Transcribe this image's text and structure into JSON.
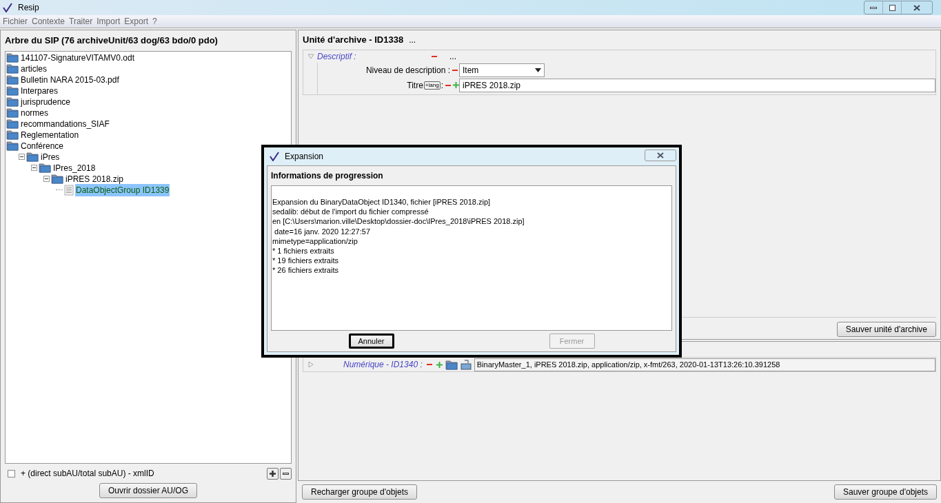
{
  "window": {
    "title": "Resip"
  },
  "menu": [
    "Fichier",
    "Contexte",
    "Traiter",
    "Import",
    "Export",
    "?"
  ],
  "tree_panel": {
    "title": "Arbre du SIP (76 archiveUnit/63 dog/63 bdo/0 pdo)",
    "items": [
      {
        "label": "141107-SignatureVITAMV0.odt",
        "kind": "folder",
        "selected": false
      },
      {
        "label": "articles",
        "kind": "folder",
        "selected": false
      },
      {
        "label": "Bulletin NARA 2015-03.pdf",
        "kind": "folder",
        "selected": false
      },
      {
        "label": "Interpares",
        "kind": "folder",
        "selected": false
      },
      {
        "label": "jurisprudence",
        "kind": "folder",
        "selected": false
      },
      {
        "label": "normes",
        "kind": "folder",
        "selected": false
      },
      {
        "label": "recommandations_SIAF",
        "kind": "folder",
        "selected": false
      },
      {
        "label": "Reglementation",
        "kind": "folder",
        "selected": false
      },
      {
        "label": "Conférence",
        "kind": "folder",
        "selected": false,
        "expanded": true,
        "children": [
          {
            "label": "iPres",
            "kind": "folder",
            "selected": false,
            "expanded": true,
            "children": [
              {
                "label": "IPres_2018",
                "kind": "folder",
                "selected": false,
                "expanded": true,
                "children": [
                  {
                    "label": "iPRES 2018.zip",
                    "kind": "folder",
                    "selected": false,
                    "expanded": true,
                    "children": [
                      {
                        "label": "DataObjectGroup ID1339",
                        "kind": "document",
                        "selected": true
                      }
                    ]
                  }
                ]
              }
            ]
          }
        ]
      }
    ],
    "checkbox": {
      "label": "+ (direct subAU/total subAU) - xmlID",
      "checked": false
    },
    "open_button": "Ouvrir dossier AU/OG"
  },
  "unit_panel": {
    "title": "Unité d'archive - ID1338",
    "more": "...",
    "section": {
      "label": "Descriptif :",
      "expanded": true,
      "more": "...",
      "fields": [
        {
          "kind": "select",
          "label": "Niveau de description :",
          "value": "Item"
        },
        {
          "kind": "text",
          "label": "Titre",
          "lang": "+lang",
          "suffix": ":",
          "value": "iPRES 2018.zip"
        }
      ]
    },
    "save_button": "Sauver unité d'archive"
  },
  "objects_panel": {
    "object": {
      "label": "Numérique - ID1340 :",
      "expanded": false,
      "value": "BinaryMaster_1, iPRES 2018.zip, application/zip, x-fmt/263, 2020-01-13T13:26:10.391258"
    },
    "reload_button": "Recharger groupe d'objets",
    "save_button": "Sauver groupe d'objets"
  },
  "dialog": {
    "title": "Expansion",
    "heading": "Informations de progression",
    "log": [
      "Expansion du BinaryDataObject ID1340, fichier [iPRES 2018.zip]",
      "sedalib: début de l'import du fichier compressé",
      "en [C:\\Users\\marion.ville\\Desktop\\dossier-doc\\IPres_2018\\iPRES 2018.zip]",
      " date=16 janv. 2020 12:27:57",
      "mimetype=application/zip",
      "* 1 fichiers extraits",
      "* 19 fichiers extraits",
      "* 26 fichiers extraits"
    ],
    "buttons": [
      {
        "label": "Annuler",
        "disabled": false,
        "focused": true
      },
      {
        "label": "Fermer",
        "disabled": true,
        "focused": false
      }
    ]
  }
}
